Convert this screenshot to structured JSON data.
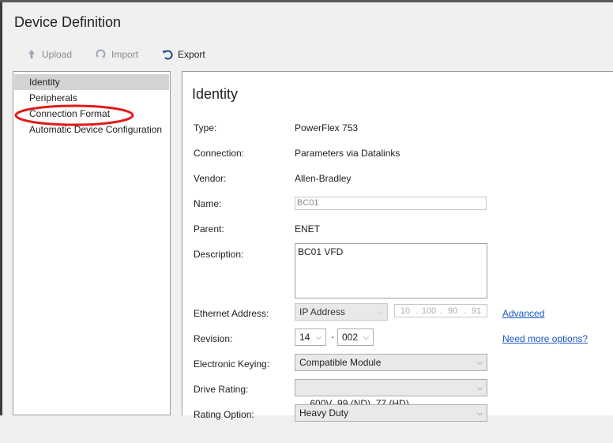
{
  "window": {
    "title": "Device Definition"
  },
  "toolbar": {
    "upload": {
      "label": "Upload",
      "icon": "upload-icon",
      "enabled": false
    },
    "import": {
      "label": "Import",
      "icon": "import-icon",
      "enabled": false
    },
    "export": {
      "label": "Export",
      "icon": "export-icon",
      "enabled": true
    }
  },
  "nav": {
    "items": [
      {
        "label": "Identity",
        "selected": true
      },
      {
        "label": "Peripherals",
        "selected": false
      },
      {
        "label": "Connection Format",
        "selected": false,
        "annotated": true
      },
      {
        "label": "Automatic Device Configuration",
        "selected": false
      }
    ],
    "annotation_color": "#e21b1b"
  },
  "content": {
    "title": "Identity",
    "type": {
      "label": "Type:",
      "value": "PowerFlex 753"
    },
    "connection": {
      "label": "Connection:",
      "value": "Parameters via Datalinks"
    },
    "vendor": {
      "label": "Vendor:",
      "value": "Allen-Bradley"
    },
    "name": {
      "label": "Name:",
      "value": "BC01"
    },
    "parent": {
      "label": "Parent:",
      "value": "ENET"
    },
    "description": {
      "label": "Description:",
      "value": "BC01 VFD"
    },
    "ethernet": {
      "label": "Ethernet Address:",
      "mode": "IP Address",
      "ip": [
        "10",
        "100",
        "90",
        "91"
      ],
      "advanced_link": "Advanced"
    },
    "revision": {
      "label": "Revision:",
      "major": "14",
      "separator": "·",
      "minor": "002",
      "more_link": "Need more options?"
    },
    "keying": {
      "label": "Electronic Keying:",
      "value": "Compatible Module"
    },
    "drive_rating": {
      "label": "Drive Rating:",
      "value": "600V  99 (ND)  77 (HD)"
    },
    "rating_option": {
      "label": "Rating Option:",
      "value": "Heavy Duty"
    }
  },
  "colors": {
    "link": "#1a56c4",
    "selected_nav": "#d3d3d3"
  }
}
